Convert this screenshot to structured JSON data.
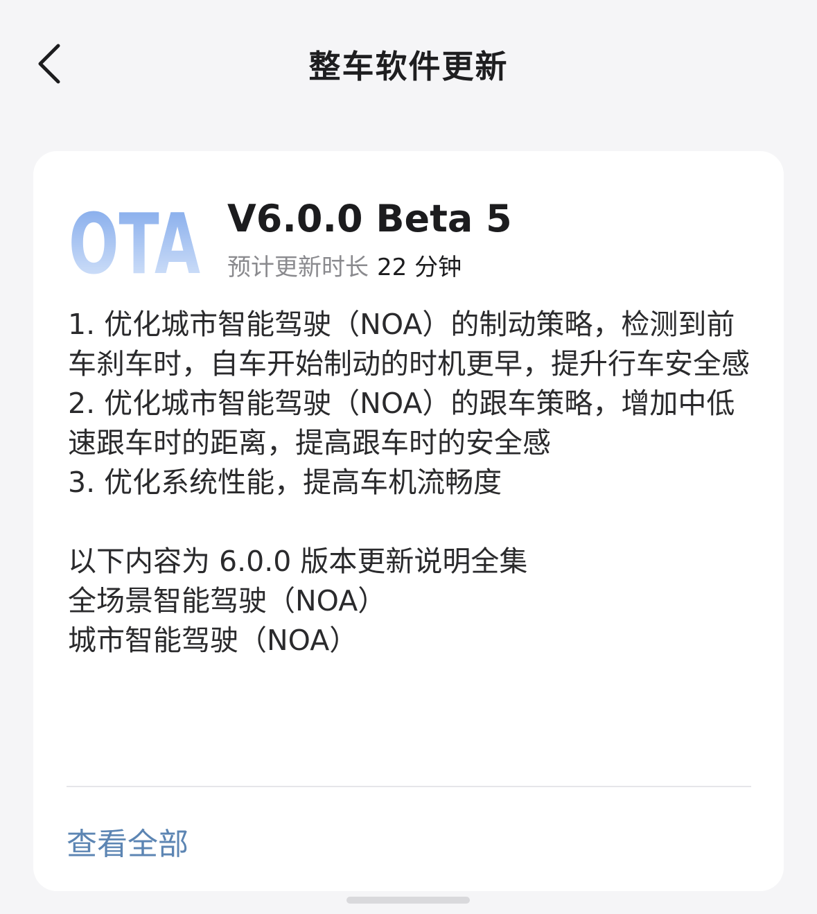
{
  "header": {
    "title": "整车软件更新",
    "back_icon": "chevron-left-icon"
  },
  "update": {
    "logo_text": "OTA",
    "logo_colors": [
      "#7da6ea",
      "#dde9fb"
    ],
    "version": "V6.0.0 Beta 5",
    "duration_label": "预计更新时长",
    "duration_value": "22 分钟",
    "notes": [
      "1. 优化城市智能驾驶（NOA）的制动策略，检测到前车刹车时，自车开始制动的时机更早，提升行车安全感",
      "2. 优化城市智能驾驶（NOA）的跟车策略，增加中低速跟车时的距离，提高跟车时的安全感",
      "3. 优化系统性能，提高车机流畅度"
    ],
    "summary": [
      "以下内容为 6.0.0 版本更新说明全集",
      "全场景智能驾驶（NOA）",
      "城市智能驾驶（NOA）"
    ],
    "view_all_label": "查看全部"
  },
  "colors": {
    "background": "#f5f5f7",
    "card": "#ffffff",
    "link": "#5c85b3",
    "secondary_text": "#8a8a8e"
  }
}
